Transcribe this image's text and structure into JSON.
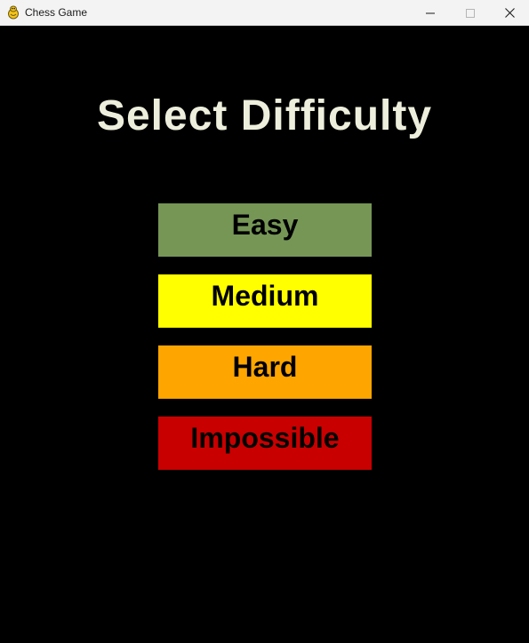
{
  "window": {
    "title": "Chess Game",
    "app_icon": "pygame-snake-icon",
    "controls": {
      "minimize_icon": "minimize-icon",
      "maximize_icon": "maximize-icon",
      "close_icon": "close-icon"
    }
  },
  "screen": {
    "heading": "Select Difficulty",
    "heading_color": "#eeeedd",
    "background_color": "#000000",
    "options": [
      {
        "label": "Easy",
        "color": "#769656"
      },
      {
        "label": "Medium",
        "color": "#ffff00"
      },
      {
        "label": "Hard",
        "color": "#ffa500"
      },
      {
        "label": "Impossible",
        "color": "#c80000"
      }
    ]
  }
}
